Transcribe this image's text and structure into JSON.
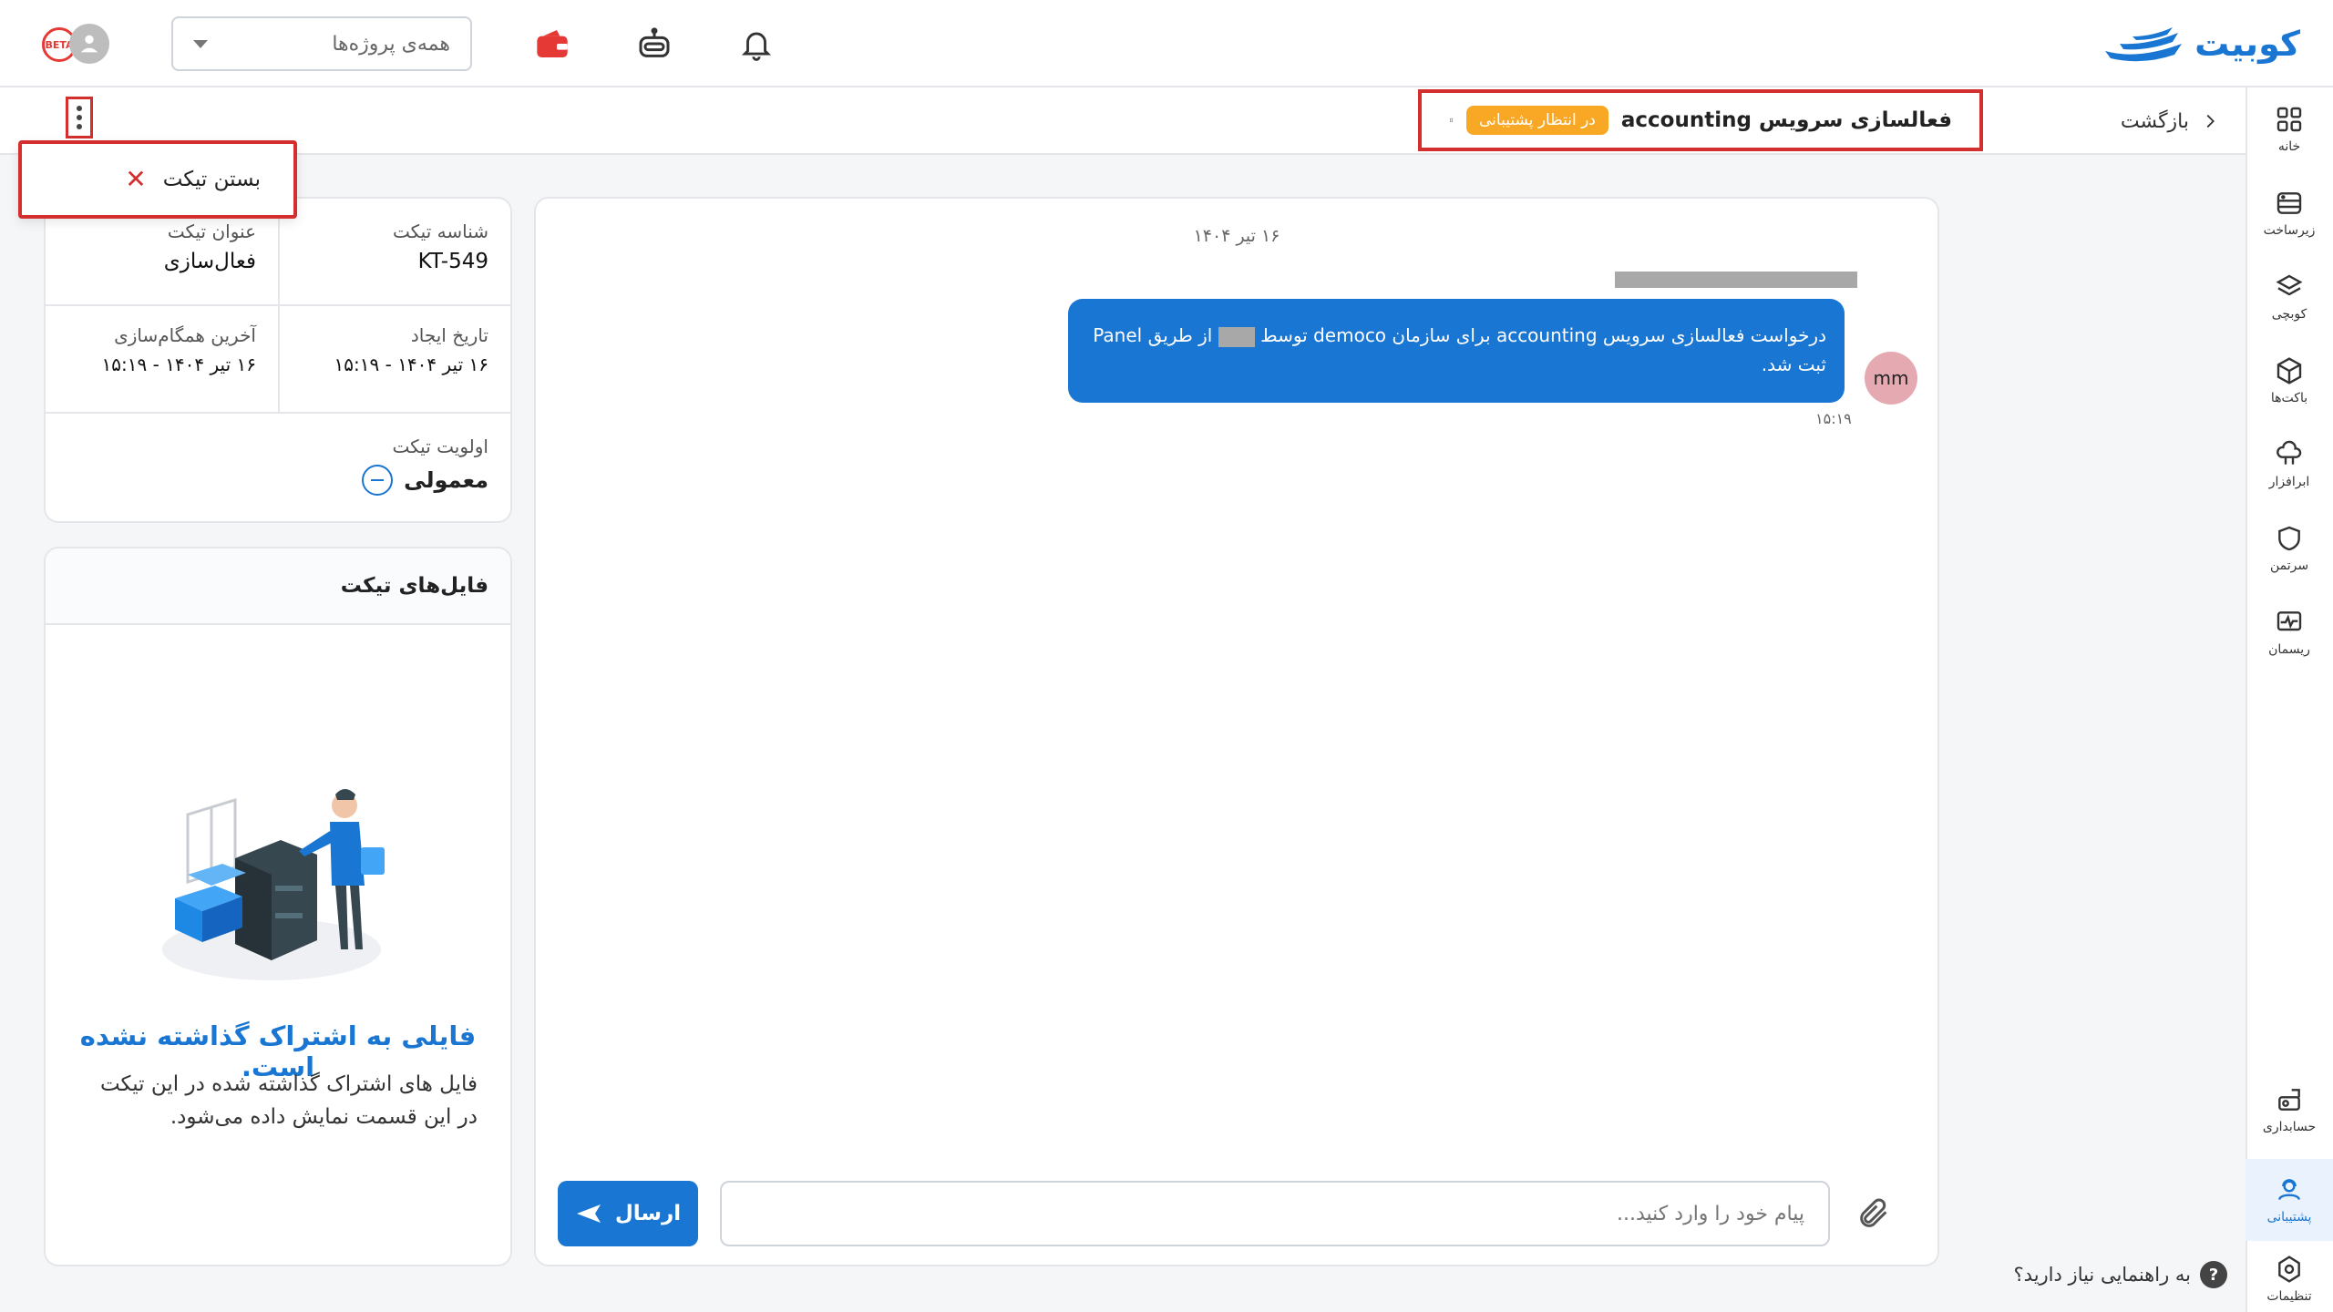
{
  "app": {
    "brand_name": "کوبیت",
    "accent_color": "#1976d2",
    "alert_color": "#d32f2f"
  },
  "header": {
    "project_selector": {
      "value": "همه‌ی پروژه‌ها"
    },
    "icons": [
      "notification-bell-icon",
      "robot-assistant-icon",
      "wallet-icon"
    ],
    "avatar_badge": "BETA"
  },
  "sidebar": {
    "items": [
      {
        "label": "خانه",
        "icon": "dashboard-grid-icon"
      },
      {
        "label": "زیرساخت",
        "icon": "server-icon"
      },
      {
        "label": "کوبچی",
        "icon": "layers-icon"
      },
      {
        "label": "باکت‌ها",
        "icon": "cube-icon"
      },
      {
        "label": "ابرافزار",
        "icon": "cloud-app-icon"
      },
      {
        "label": "سرتمن",
        "icon": "shield-icon"
      },
      {
        "label": "ریسمان",
        "icon": "monitor-pulse-icon"
      },
      {
        "label": "حسابداری",
        "icon": "accounting-icon"
      },
      {
        "label": "پشتیبانی",
        "icon": "support-icon",
        "active": true
      },
      {
        "label": "تنظیمات",
        "icon": "settings-icon"
      }
    ]
  },
  "subbar": {
    "back_label": "بازگشت",
    "ticket_title": "فعالسازی سرویس accounting",
    "status_label": "در انتظار پشتیبانی"
  },
  "menu": {
    "close_ticket_label": "بستن تیکت"
  },
  "ticket_info": {
    "id_label": "شناسه تیکت",
    "id_value": "KT-549",
    "title_label": "عنوان تیکت",
    "title_value": "فعال‌سازی",
    "created_label": "تاریخ ایجاد",
    "created_value": "۱۶ تیر ۱۴۰۴ - ۱۵:۱۹",
    "synced_label": "آخرین همگام‌سازی",
    "synced_value": "۱۶ تیر ۱۴۰۴ - ۱۵:۱۹",
    "priority_label": "اولویت تیکت",
    "priority_value": "معمولی"
  },
  "files": {
    "header": "فایل‌های تیکت",
    "empty_title": "فایلی به اشتراک گذاشته نشده است.",
    "empty_desc": "فایل های اشتراک گذاشته شده در این تیکت در این قسمت نمایش داده می‌شود."
  },
  "chat": {
    "date": "۱۶ تیر ۱۴۰۴",
    "message": {
      "text_before": "درخواست فعالسازی سرویس accounting برای سازمان democo توسط",
      "text_after": "از طریق Panel ثبت شد.",
      "avatar": "mm",
      "time": "۱۵:۱۹"
    },
    "composer_placeholder": "پیام خود را وارد کنید...",
    "send_label": "ارسال"
  },
  "help": {
    "label": "به راهنمایی نیاز دارید؟",
    "icon_text": "?"
  }
}
